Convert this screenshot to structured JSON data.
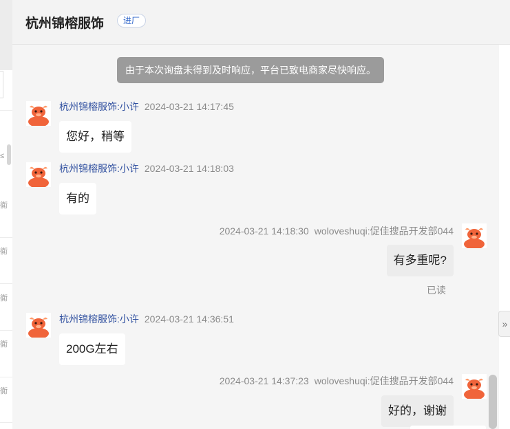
{
  "header": {
    "title": "杭州锦榕服饰",
    "badge": "进厂"
  },
  "notice": "由于本次询盘未得到及时响应，平台已致电商家尽快响应。",
  "messages": [
    {
      "name": "杭州锦榕服饰:小许",
      "time": "2024-03-21 14:17:45",
      "text": "您好，稍等"
    },
    {
      "name": "杭州锦榕服饰:小许",
      "time": "2024-03-21 14:18:03",
      "text": "有的"
    },
    {
      "name": "woloveshuqi:促佳搜品开发部044",
      "time": "2024-03-21 14:18:30",
      "text": "有多重呢?",
      "status": "已读"
    },
    {
      "name": "杭州锦榕服饰:小许",
      "time": "2024-03-21 14:36:51",
      "text": "200G左右"
    },
    {
      "name": "woloveshuqi:促佳搜品开发部044",
      "time": "2024-03-21 14:37:23",
      "text": "好的，谢谢"
    }
  ],
  "sidebar_glyphs": [
    "≤",
    "衠",
    "衠",
    "衠",
    "衠",
    "衠"
  ],
  "collapse_glyph": "»",
  "colors": {
    "name_link": "#2f4f9f",
    "avatar_orange": "#f0643a",
    "notice_bg": "#9b9b9b"
  }
}
